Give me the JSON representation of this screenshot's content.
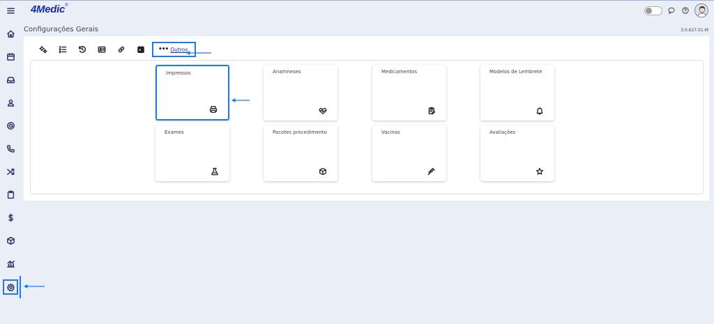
{
  "app": {
    "logo": "4Medic",
    "logo_mark": "®"
  },
  "header": {
    "page_title": "Configurações Gerais",
    "version": "3.0.627.01-M"
  },
  "toolbar": {
    "outros_label": "Outros",
    "outros_dots": "•••"
  },
  "cards": [
    {
      "label": "Impressos",
      "icon": "printer-icon"
    },
    {
      "label": "Anamneses",
      "icon": "heart-pulse-icon"
    },
    {
      "label": "Medicamentos",
      "icon": "clipboard-edit-icon"
    },
    {
      "label": "Modelos de Lembrete",
      "icon": "bell-icon"
    },
    {
      "label": "Exames",
      "icon": "flask-icon"
    },
    {
      "label": "Pacotes procedimento",
      "icon": "package-icon"
    },
    {
      "label": "Vacinas",
      "icon": "syringe-icon"
    },
    {
      "label": "Avaliações",
      "icon": "star-icon"
    }
  ],
  "colors": {
    "accent": "#1e7be6",
    "brand": "#1a2aa8",
    "background": "#eaeef7"
  }
}
